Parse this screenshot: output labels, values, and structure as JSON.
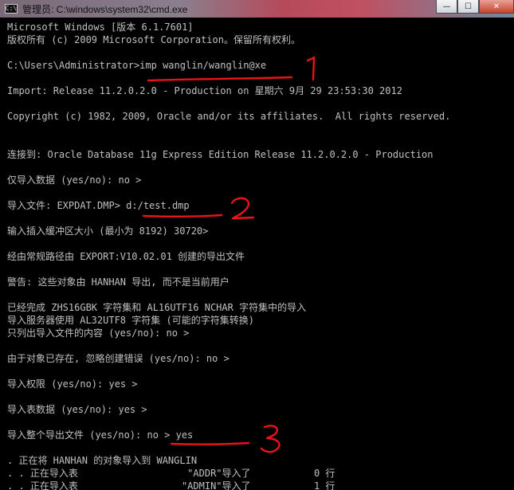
{
  "window": {
    "title": "管理员: C:\\windows\\system32\\cmd.exe",
    "icon": "cmd-icon",
    "icon_glyph": "C:\\",
    "buttons": {
      "minimize": "minimize-icon",
      "maximize": "maximize-icon",
      "close": "close-icon",
      "minimize_glyph": "—",
      "maximize_glyph": "☐",
      "close_glyph": "✕"
    }
  },
  "console": {
    "lines": [
      "Microsoft Windows [版本 6.1.7601]",
      "版权所有 (c) 2009 Microsoft Corporation。保留所有权利。",
      "C:\\Users\\Administrator>imp wanglin/wanglin@xe",
      "Import: Release 11.2.0.2.0 - Production on 星期六 9月 29 23:53:30 2012",
      "Copyright (c) 1982, 2009, Oracle and/or its affiliates.  All rights reserved.",
      "连接到: Oracle Database 11g Express Edition Release 11.2.0.2.0 - Production",
      "仅导入数据 (yes/no): no >",
      "导入文件: EXPDAT.DMP> d:/test.dmp",
      "输入插入缓冲区大小 (最小为 8192) 30720>",
      "经由常规路径由 EXPORT:V10.02.01 创建的导出文件",
      "警告: 这些对象由 HANHAN 导出, 而不是当前用户",
      "已经完成 ZHS16GBK 字符集和 AL16UTF16 NCHAR 字符集中的导入",
      "导入服务器使用 AL32UTF8 字符集 (可能的字符集转换)",
      "只列出导入文件的内容 (yes/no): no >",
      "由于对象已存在, 忽略创建错误 (yes/no): no >",
      "导入权限 (yes/no): yes >",
      "导入表数据 (yes/no): yes >",
      "导入整个导出文件 (yes/no): no > yes",
      ". 正在将 HANHAN 的对象导入到 WANGLIN",
      ". . 正在导入表                   \"ADDR\"导入了           0 行",
      ". . 正在导入表                  \"ADMIN\"导入了           1 行"
    ]
  },
  "annotations": {
    "color": "#e8141a",
    "marks": [
      "1",
      "2",
      "3"
    ]
  }
}
